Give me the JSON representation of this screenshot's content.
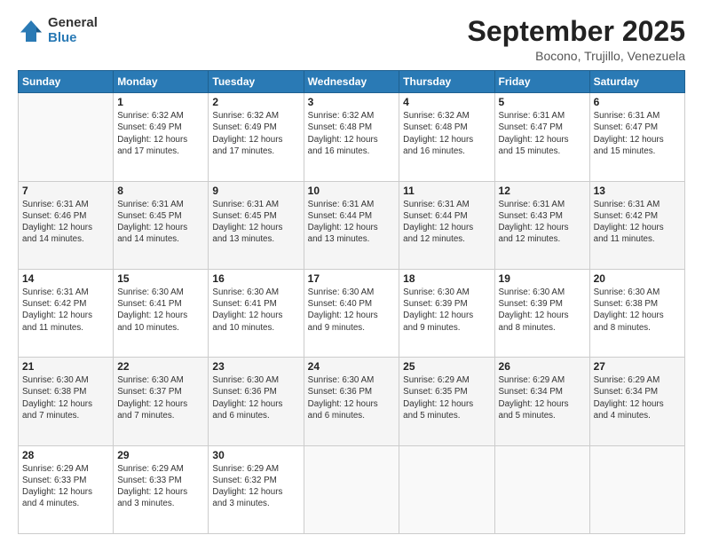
{
  "logo": {
    "general": "General",
    "blue": "Blue"
  },
  "header": {
    "month": "September 2025",
    "location": "Bocono, Trujillo, Venezuela"
  },
  "days_of_week": [
    "Sunday",
    "Monday",
    "Tuesday",
    "Wednesday",
    "Thursday",
    "Friday",
    "Saturday"
  ],
  "weeks": [
    [
      {
        "day": "",
        "info": ""
      },
      {
        "day": "1",
        "info": "Sunrise: 6:32 AM\nSunset: 6:49 PM\nDaylight: 12 hours\nand 17 minutes."
      },
      {
        "day": "2",
        "info": "Sunrise: 6:32 AM\nSunset: 6:49 PM\nDaylight: 12 hours\nand 17 minutes."
      },
      {
        "day": "3",
        "info": "Sunrise: 6:32 AM\nSunset: 6:48 PM\nDaylight: 12 hours\nand 16 minutes."
      },
      {
        "day": "4",
        "info": "Sunrise: 6:32 AM\nSunset: 6:48 PM\nDaylight: 12 hours\nand 16 minutes."
      },
      {
        "day": "5",
        "info": "Sunrise: 6:31 AM\nSunset: 6:47 PM\nDaylight: 12 hours\nand 15 minutes."
      },
      {
        "day": "6",
        "info": "Sunrise: 6:31 AM\nSunset: 6:47 PM\nDaylight: 12 hours\nand 15 minutes."
      }
    ],
    [
      {
        "day": "7",
        "info": "Sunrise: 6:31 AM\nSunset: 6:46 PM\nDaylight: 12 hours\nand 14 minutes."
      },
      {
        "day": "8",
        "info": "Sunrise: 6:31 AM\nSunset: 6:45 PM\nDaylight: 12 hours\nand 14 minutes."
      },
      {
        "day": "9",
        "info": "Sunrise: 6:31 AM\nSunset: 6:45 PM\nDaylight: 12 hours\nand 13 minutes."
      },
      {
        "day": "10",
        "info": "Sunrise: 6:31 AM\nSunset: 6:44 PM\nDaylight: 12 hours\nand 13 minutes."
      },
      {
        "day": "11",
        "info": "Sunrise: 6:31 AM\nSunset: 6:44 PM\nDaylight: 12 hours\nand 12 minutes."
      },
      {
        "day": "12",
        "info": "Sunrise: 6:31 AM\nSunset: 6:43 PM\nDaylight: 12 hours\nand 12 minutes."
      },
      {
        "day": "13",
        "info": "Sunrise: 6:31 AM\nSunset: 6:42 PM\nDaylight: 12 hours\nand 11 minutes."
      }
    ],
    [
      {
        "day": "14",
        "info": "Sunrise: 6:31 AM\nSunset: 6:42 PM\nDaylight: 12 hours\nand 11 minutes."
      },
      {
        "day": "15",
        "info": "Sunrise: 6:30 AM\nSunset: 6:41 PM\nDaylight: 12 hours\nand 10 minutes."
      },
      {
        "day": "16",
        "info": "Sunrise: 6:30 AM\nSunset: 6:41 PM\nDaylight: 12 hours\nand 10 minutes."
      },
      {
        "day": "17",
        "info": "Sunrise: 6:30 AM\nSunset: 6:40 PM\nDaylight: 12 hours\nand 9 minutes."
      },
      {
        "day": "18",
        "info": "Sunrise: 6:30 AM\nSunset: 6:39 PM\nDaylight: 12 hours\nand 9 minutes."
      },
      {
        "day": "19",
        "info": "Sunrise: 6:30 AM\nSunset: 6:39 PM\nDaylight: 12 hours\nand 8 minutes."
      },
      {
        "day": "20",
        "info": "Sunrise: 6:30 AM\nSunset: 6:38 PM\nDaylight: 12 hours\nand 8 minutes."
      }
    ],
    [
      {
        "day": "21",
        "info": "Sunrise: 6:30 AM\nSunset: 6:38 PM\nDaylight: 12 hours\nand 7 minutes."
      },
      {
        "day": "22",
        "info": "Sunrise: 6:30 AM\nSunset: 6:37 PM\nDaylight: 12 hours\nand 7 minutes."
      },
      {
        "day": "23",
        "info": "Sunrise: 6:30 AM\nSunset: 6:36 PM\nDaylight: 12 hours\nand 6 minutes."
      },
      {
        "day": "24",
        "info": "Sunrise: 6:30 AM\nSunset: 6:36 PM\nDaylight: 12 hours\nand 6 minutes."
      },
      {
        "day": "25",
        "info": "Sunrise: 6:29 AM\nSunset: 6:35 PM\nDaylight: 12 hours\nand 5 minutes."
      },
      {
        "day": "26",
        "info": "Sunrise: 6:29 AM\nSunset: 6:34 PM\nDaylight: 12 hours\nand 5 minutes."
      },
      {
        "day": "27",
        "info": "Sunrise: 6:29 AM\nSunset: 6:34 PM\nDaylight: 12 hours\nand 4 minutes."
      }
    ],
    [
      {
        "day": "28",
        "info": "Sunrise: 6:29 AM\nSunset: 6:33 PM\nDaylight: 12 hours\nand 4 minutes."
      },
      {
        "day": "29",
        "info": "Sunrise: 6:29 AM\nSunset: 6:33 PM\nDaylight: 12 hours\nand 3 minutes."
      },
      {
        "day": "30",
        "info": "Sunrise: 6:29 AM\nSunset: 6:32 PM\nDaylight: 12 hours\nand 3 minutes."
      },
      {
        "day": "",
        "info": ""
      },
      {
        "day": "",
        "info": ""
      },
      {
        "day": "",
        "info": ""
      },
      {
        "day": "",
        "info": ""
      }
    ]
  ]
}
